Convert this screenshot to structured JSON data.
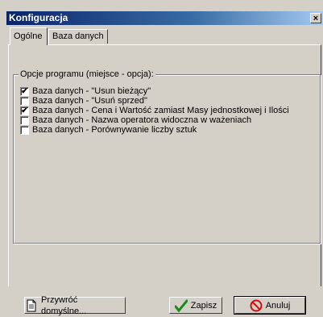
{
  "window": {
    "title": "Konfiguracja",
    "close_label": "×"
  },
  "tabs": [
    {
      "label": "Ogólne",
      "active": true
    },
    {
      "label": "Baza danych",
      "active": false
    }
  ],
  "group": {
    "legend": "Opcje programu (miejsce - opcja):"
  },
  "options": [
    {
      "label": "Baza danych - \"Usun bieżący\"",
      "checked": true
    },
    {
      "label": "Baza danych - \"Usuń sprzed\"",
      "checked": false
    },
    {
      "label": "Baza danych - Cena i Wartość zamiast Masy jednostkowej i Ilości",
      "checked": true
    },
    {
      "label": "Baza danych - Nazwa operatora widoczna w ważeniach",
      "checked": false
    },
    {
      "label": "Baza danych - Porównywanie liczby sztuk",
      "checked": false
    }
  ],
  "buttons": {
    "restore": {
      "label": "Przywróć domyślne...",
      "icon": "document-icon"
    },
    "save": {
      "label": "Zapisz",
      "icon": "checkmark-icon",
      "color": "#1a8a1a"
    },
    "cancel": {
      "label": "Anuluj",
      "icon": "no-entry-icon",
      "color": "#d01010"
    }
  }
}
